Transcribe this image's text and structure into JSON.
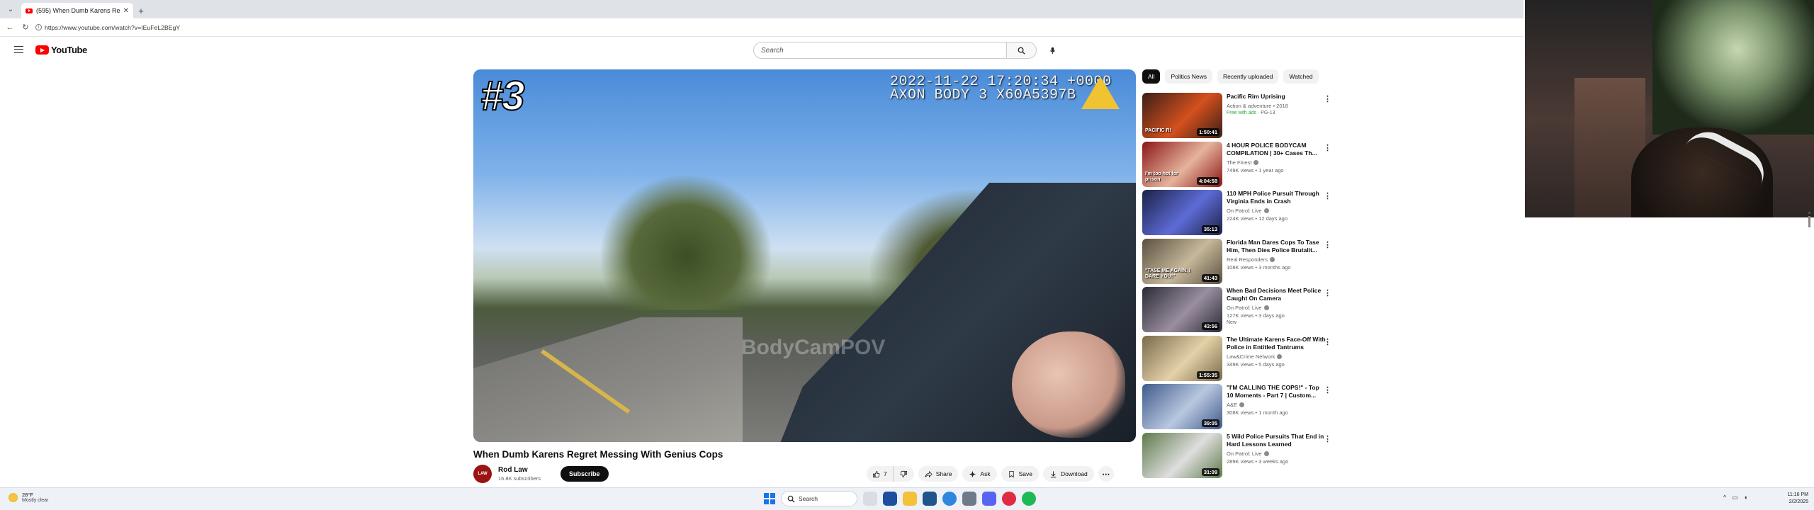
{
  "browser": {
    "tab_title": "(595) When Dumb Karens Re",
    "url": "https://www.youtube.com/watch?v=IEuFeL2BEgY"
  },
  "header": {
    "logo_text": "YouTube",
    "search_placeholder": "Search"
  },
  "player": {
    "episode_number": "#3",
    "timestamp_line1": "2022-11-22 17:20:34 +0000",
    "timestamp_line2": "AXON BODY 3 X60A5397B",
    "watermark": "BodyCamPOV"
  },
  "video": {
    "title": "When Dumb Karens Regret Messing With Genius Cops",
    "channel_name": "Rod Law",
    "avatar_text": "LAW",
    "subscribers": "16.8K subscribers",
    "subscribe_label": "Subscribe",
    "like_count": "7",
    "share_label": "Share",
    "ask_label": "Ask",
    "save_label": "Save",
    "download_label": "Download"
  },
  "chips": [
    "All",
    "Politics News",
    "Recently uploaded",
    "Watched"
  ],
  "recommendations": [
    {
      "title": "Pacific Rim Uprising",
      "channel": "Action & adventure • 2018",
      "stats": "",
      "badge_free": "Free with ads",
      "badge_rating": "· PG-13",
      "duration": "1:50:41",
      "thumb_text": "PACIFIC RI",
      "thumb_bg": "#3b1f17",
      "thumb_accent": "#d4501e"
    },
    {
      "title": "4 HOUR POLICE BODYCAM COMPILATION | 30+ Cases Th...",
      "channel": "The Finest",
      "stats": "749K views • 1 year ago",
      "duration": "4:04:58",
      "thumb_text": "I'm too hot for prison",
      "thumb_bg": "#8a1616",
      "thumb_accent": "#e6b39c"
    },
    {
      "title": "110 MPH Police Pursuit Through Virginia Ends in Crash",
      "channel": "On Patrol: Live",
      "stats": "224K views • 12 days ago",
      "duration": "35:13",
      "thumb_text": "",
      "thumb_bg": "#1b2247",
      "thumb_accent": "#5e6bd6"
    },
    {
      "title": "Florida Man Dares Cops To Tase Him, Then Dies Police Brutalit...",
      "channel": "Real Responders",
      "stats": "108K views • 3 months ago",
      "duration": "41:43",
      "thumb_text": "\"TASE ME AGAIN, I DARE YOU!\"",
      "thumb_bg": "#5a5040",
      "thumb_accent": "#c6b89a"
    },
    {
      "title": "When Bad Decisions Meet Police Caught On Camera",
      "channel": "On Patrol: Live",
      "stats": "127K views • 3 days ago",
      "badge_new": "New",
      "duration": "43:56",
      "thumb_text": "",
      "thumb_bg": "#2a2a33",
      "thumb_accent": "#9a8ea0"
    },
    {
      "title": "The Ultimate Karens Face-Off With Police in Entitled Tantrums",
      "channel": "Law&Crime Network",
      "stats": "349K views • 5 days ago",
      "duration": "1:55:35",
      "thumb_text": "",
      "thumb_bg": "#7a6a4a",
      "thumb_accent": "#e3d1a8"
    },
    {
      "title": "\"I'M CALLING THE COPS!\" - Top 10 Moments - Part 7 | Custom...",
      "channel": "A&E",
      "stats": "308K views • 1 month ago",
      "duration": "39:05",
      "thumb_text": "",
      "thumb_bg": "#3f5a8a",
      "thumb_accent": "#b9c8e0"
    },
    {
      "title": "5 Wild Police Pursuits That End in Hard Lessons Learned",
      "channel": "On Patrol: Live",
      "stats": "289K views • 3 weeks ago",
      "duration": "31:09",
      "thumb_text": "",
      "thumb_bg": "#5e7a4a",
      "thumb_accent": "#dedede"
    }
  ],
  "taskbar": {
    "temperature": "28°F",
    "weather_desc": "Mostly clear",
    "search_label": "Search",
    "time": "11:16 PM",
    "date": "2/2/2025"
  }
}
